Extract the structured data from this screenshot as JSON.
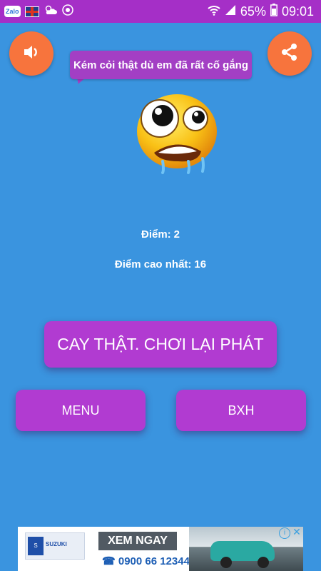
{
  "status_bar": {
    "left_icons": [
      "zalo-icon",
      "uk-flag-icon",
      "weather-icon",
      "app-icon"
    ],
    "zalo_label": "Zalo",
    "battery": "65%",
    "time": "09:01"
  },
  "buttons": {
    "sound_icon": "speaker-icon",
    "share_icon": "share-icon",
    "replay_label": "CAY THẬT. CHƠI LẠI PHÁT",
    "menu_label": "MENU",
    "leaderboard_label": "BXH"
  },
  "speech": {
    "text": "Kém cỏi thật dù em đã rất cố gắng"
  },
  "result": {
    "score_label": "Điểm:",
    "score_value": "2",
    "best_label": "Điểm cao nhất:",
    "best_value": "16"
  },
  "ad": {
    "brand": "SUZUKI",
    "cta": "XEM NGAY",
    "phone": "0900 66 12344"
  },
  "colors": {
    "background": "#3a94df",
    "status_bar": "#a52fc7",
    "orange": "#f7743d",
    "purple_button": "#b13bd1"
  }
}
